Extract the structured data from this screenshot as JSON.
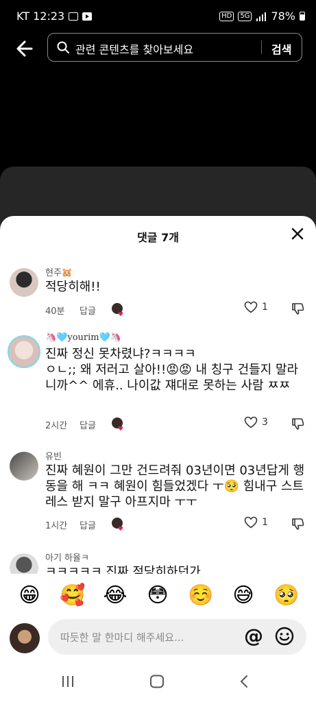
{
  "status": {
    "carrier_time": "KT 12:23",
    "hd": "HD",
    "network": "5G",
    "battery": "78%"
  },
  "search": {
    "placeholder": "관련 콘텐츠를 찾아보세요",
    "button": "검색"
  },
  "sheet": {
    "title": "댓글 7개"
  },
  "comments": [
    {
      "username": "현주🐹",
      "text": "적당히해!!",
      "time": "40분",
      "reply": "답글",
      "likes": "1"
    },
    {
      "username": "🦄🩵yourim🩵🦄",
      "text": "진짜 정신 못차렸냐?ㅋㅋㅋㅋ\nㅇㄴ;; 왜 저러고 살아!!😡😡 내 칭구 건들지 말라니까^^ 에휴.. 나이값 쟤대로 못하는 사람 ㅉㅉ",
      "time": "2시간",
      "reply": "답글",
      "likes": "3"
    },
    {
      "username": "유빈",
      "text": "진짜 혜원이 그만 건드려줘 03년이면 03년답게 행동을 해 ㅋㅋ 혜원이 힘들었겠다 ㅜ🥺 힘내구 스트레스 받지 말구 아프지마 ㅜㅜ",
      "time": "1시간",
      "reply": "답글",
      "likes": "1"
    },
    {
      "username": "아기 하율ㅋ",
      "text": "ㅋㅋㅋㅋㅋ 진짜 적당히하던가"
    }
  ],
  "emojis": [
    "😁",
    "🥰",
    "😂",
    "😳",
    "☺️",
    "😅",
    "🥺"
  ],
  "composer": {
    "placeholder": "따듯한 말 한마디 해주세요...",
    "at_symbol": "@"
  },
  "colors": {
    "background": "#000000",
    "sheet": "#ffffff",
    "heart": "#e0245e"
  }
}
